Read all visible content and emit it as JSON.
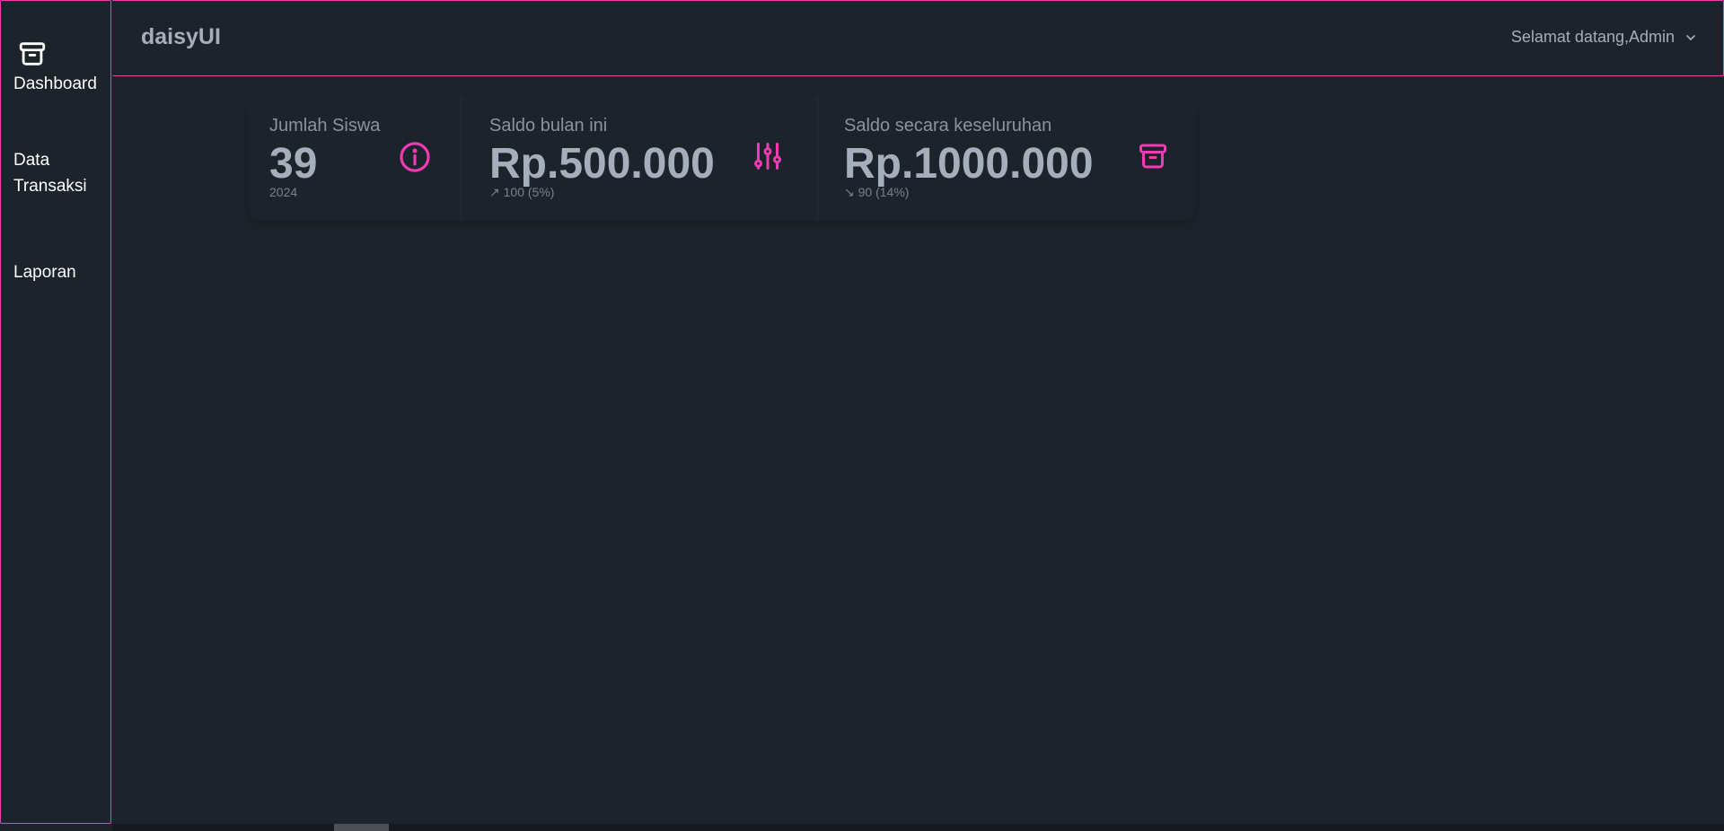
{
  "app": {
    "brand": "daisyUI",
    "accent_color": "#f03cb4"
  },
  "sidebar": {
    "items": [
      {
        "label": "Dashboard",
        "icon": "archive-box-icon"
      },
      {
        "label": "Data Transaksi"
      },
      {
        "label": "Laporan"
      }
    ]
  },
  "navbar": {
    "greeting": "Selamat datang,Admin",
    "dropdown_icon": "chevron-down-icon"
  },
  "stats": [
    {
      "title": "Jumlah Siswa",
      "value": "39",
      "desc": "2024",
      "icon": "info-circle-icon"
    },
    {
      "title": "Saldo bulan ini",
      "value": "Rp.500.000",
      "desc": "↗︎ 100 (5%)",
      "icon": "adjustments-sliders-icon"
    },
    {
      "title": "Saldo secara keseluruhan",
      "value": "Rp.1000.000",
      "desc": "↘︎ 90 (14%)",
      "icon": "archive-box-icon"
    }
  ]
}
